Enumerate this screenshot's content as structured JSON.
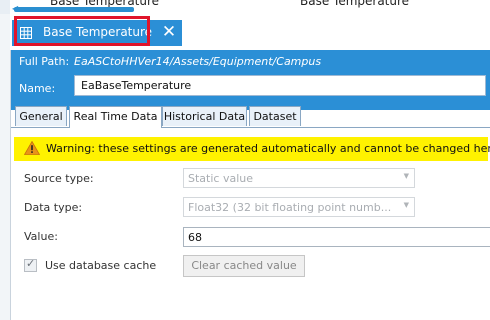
{
  "top_strip": {
    "left_text": "Base Temperature",
    "right_text": "Base Temperature"
  },
  "doc_tab": {
    "title": "Base Temperature",
    "close_symbol": "✕",
    "icon": "grid-icon"
  },
  "header": {
    "full_path_label": "Full Path:",
    "full_path_value": "EaASCtoHHVer14/Assets/Equipment/Campus",
    "name_label": "Name:",
    "name_value": "EaBaseTemperature"
  },
  "tabs": [
    {
      "label": "General",
      "active": false
    },
    {
      "label": "Real Time Data",
      "active": true
    },
    {
      "label": "Historical Data",
      "active": false
    },
    {
      "label": "Dataset",
      "active": false
    }
  ],
  "warning": {
    "text": "Warning: these settings are generated automatically and cannot be changed here.",
    "icon": "warning-icon"
  },
  "form": {
    "source_type_label": "Source type:",
    "source_type_value": "Static value",
    "data_type_label": "Data type:",
    "data_type_value": "Float32 (32 bit floating point numb...",
    "value_label": "Value:",
    "value_value": "68",
    "cache_label": "Use database cache",
    "cache_checked": true,
    "clear_cache_button": "Clear cached value"
  },
  "colors": {
    "accent": "#2b8fd6",
    "highlight_box": "#e0142a",
    "warning_bg": "#fff200"
  }
}
